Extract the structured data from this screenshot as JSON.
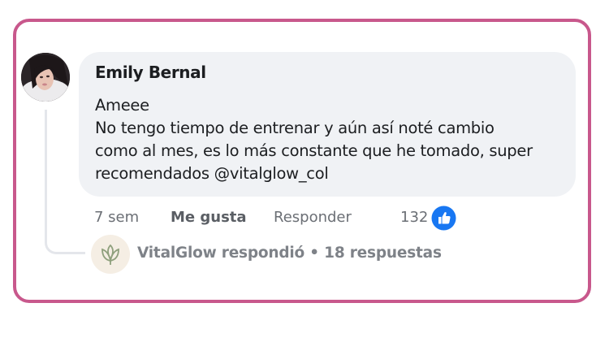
{
  "comment": {
    "author": "Emily Bernal",
    "lines": [
      "Ameee",
      "No tengo tiempo de entrenar y aún así noté cambio",
      "como al mes, es lo más constante que he tomado, super",
      "recomendados @vitalglow_col"
    ]
  },
  "actions": {
    "time": "7 sem",
    "like_label": "Me gusta",
    "reply_label": "Responder",
    "like_count": "132"
  },
  "reply_summary": {
    "text": "VitalGlow respondió • 18 respuestas"
  },
  "colors": {
    "card_border": "#c8588c",
    "bubble_bg": "#f0f2f5",
    "like_blue": "#1877f2",
    "brand_beige": "#f5eee4",
    "brand_green": "#8fa07d"
  },
  "icons": {
    "avatar": "user-photo-avatar",
    "like": "thumbs-up-icon",
    "reply_avatar": "vitalglow-lotus-logo"
  }
}
